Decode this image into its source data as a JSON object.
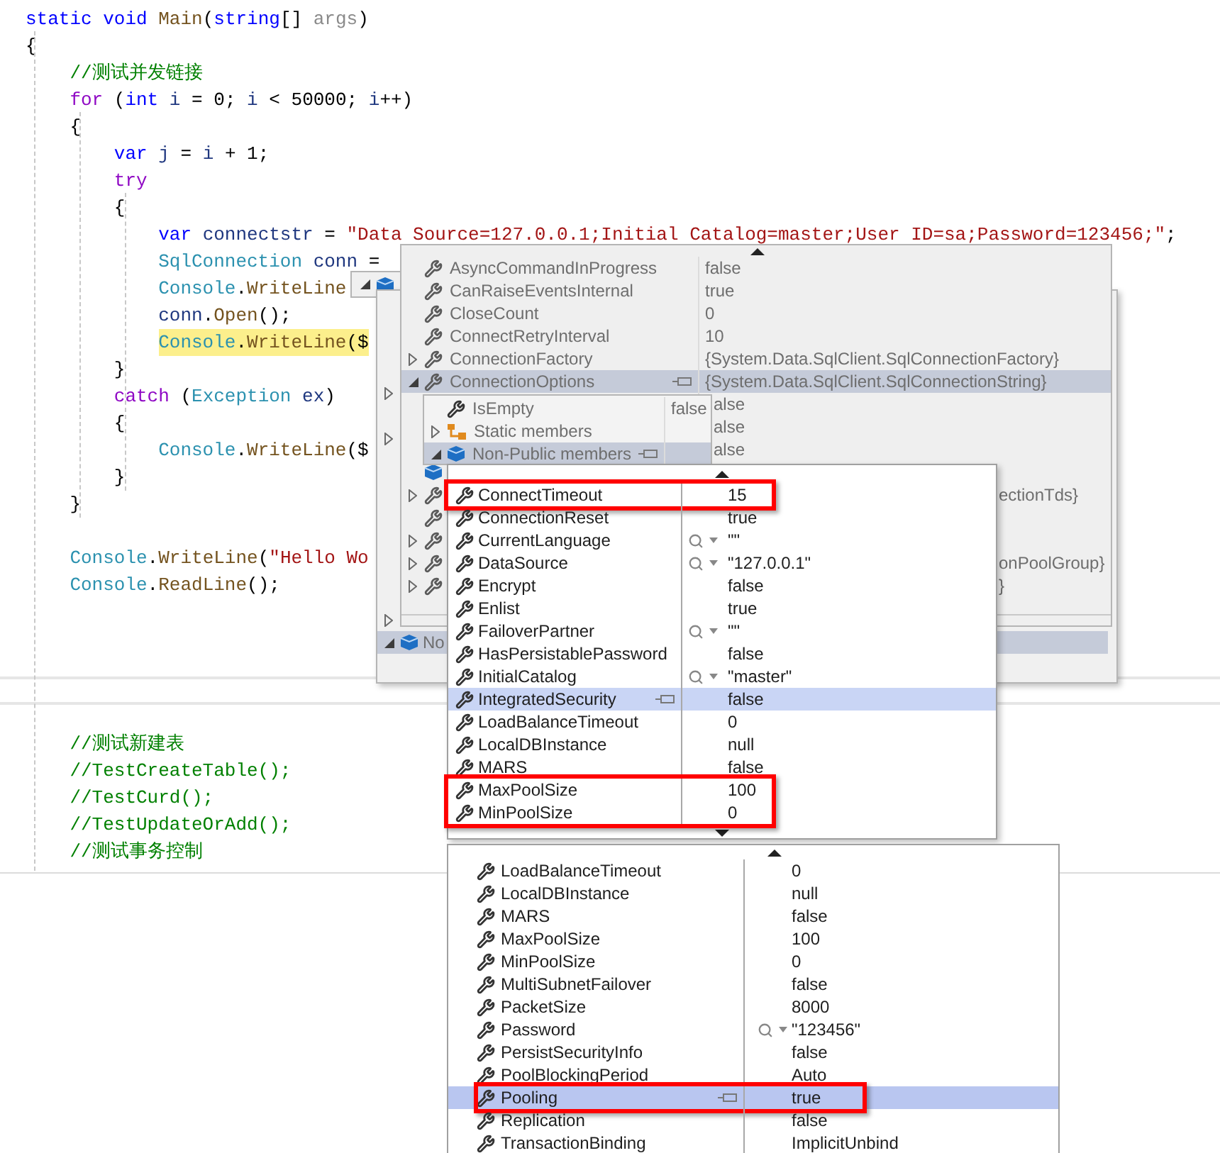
{
  "editor": {
    "blocks": [
      {
        "lines": [
          {
            "tokens": [
              {
                "kind": "keyword",
                "text": "static "
              },
              {
                "kind": "keyword",
                "text": "void "
              },
              {
                "kind": "method",
                "text": "Main"
              },
              {
                "kind": "plain",
                "text": "("
              },
              {
                "kind": "keyword",
                "text": "string"
              },
              {
                "kind": "plain",
                "text": "[] "
              },
              {
                "kind": "param",
                "text": "args"
              },
              {
                "kind": "plain",
                "text": ")"
              }
            ]
          },
          {
            "tokens": [
              {
                "kind": "plain",
                "text": "{"
              }
            ],
            "children": [
              {
                "tokens": [
                  {
                    "kind": "comment",
                    "text": "//测试并发链接"
                  }
                ]
              },
              {
                "tokens": [
                  {
                    "kind": "control",
                    "text": "for"
                  },
                  {
                    "kind": "plain",
                    "text": " ("
                  },
                  {
                    "kind": "keyword",
                    "text": "int "
                  },
                  {
                    "kind": "local",
                    "text": "i"
                  },
                  {
                    "kind": "plain",
                    "text": " = 0; "
                  },
                  {
                    "kind": "local",
                    "text": "i"
                  },
                  {
                    "kind": "plain",
                    "text": " < 50000; "
                  },
                  {
                    "kind": "local",
                    "text": "i"
                  },
                  {
                    "kind": "plain",
                    "text": "++)"
                  }
                ]
              },
              {
                "tokens": [
                  {
                    "kind": "plain",
                    "text": "{"
                  }
                ],
                "children": [
                  {
                    "tokens": [
                      {
                        "kind": "keyword",
                        "text": "var "
                      },
                      {
                        "kind": "local",
                        "text": "j"
                      },
                      {
                        "kind": "plain",
                        "text": " = "
                      },
                      {
                        "kind": "local",
                        "text": "i"
                      },
                      {
                        "kind": "plain",
                        "text": " + 1;"
                      }
                    ]
                  },
                  {
                    "tokens": [
                      {
                        "kind": "control",
                        "text": "try"
                      }
                    ]
                  },
                  {
                    "tokens": [
                      {
                        "kind": "plain",
                        "text": "{"
                      }
                    ],
                    "children": [
                      {
                        "tokens": [
                          {
                            "kind": "keyword",
                            "text": "var "
                          },
                          {
                            "kind": "local",
                            "text": "connectstr"
                          },
                          {
                            "kind": "plain",
                            "text": " = "
                          },
                          {
                            "kind": "string",
                            "text": "\"Data Source=127.0.0.1;Initial Catalog=master;User ID=sa;Password=123456;\""
                          },
                          {
                            "kind": "plain",
                            "text": ";"
                          }
                        ]
                      },
                      {
                        "tokens": [
                          {
                            "kind": "type",
                            "text": "SqlConnection "
                          },
                          {
                            "kind": "local",
                            "text": "conn"
                          },
                          {
                            "kind": "plain",
                            "text": " ="
                          }
                        ]
                      },
                      {
                        "tokens": [
                          {
                            "kind": "type",
                            "text": "Console"
                          },
                          {
                            "kind": "plain",
                            "text": "."
                          },
                          {
                            "kind": "method",
                            "text": "WriteLine"
                          }
                        ]
                      },
                      {
                        "tokens": [
                          {
                            "kind": "local",
                            "text": "conn"
                          },
                          {
                            "kind": "plain",
                            "text": "."
                          },
                          {
                            "kind": "method",
                            "text": "Open"
                          },
                          {
                            "kind": "plain",
                            "text": "();"
                          }
                        ]
                      },
                      {
                        "current": true,
                        "tokens": [
                          {
                            "kind": "type",
                            "text": "Console"
                          },
                          {
                            "kind": "plain",
                            "text": "."
                          },
                          {
                            "kind": "method",
                            "text": "WriteLine"
                          },
                          {
                            "kind": "plain",
                            "text": "($"
                          }
                        ]
                      }
                    ]
                  },
                  {
                    "tokens": [
                      {
                        "kind": "plain",
                        "text": "}"
                      }
                    ]
                  },
                  {
                    "tokens": [
                      {
                        "kind": "control",
                        "text": "catch"
                      },
                      {
                        "kind": "plain",
                        "text": " ("
                      },
                      {
                        "kind": "type",
                        "text": "Exception "
                      },
                      {
                        "kind": "local",
                        "text": "ex"
                      },
                      {
                        "kind": "plain",
                        "text": ")"
                      }
                    ]
                  },
                  {
                    "tokens": [
                      {
                        "kind": "plain",
                        "text": "{"
                      }
                    ],
                    "children": [
                      {
                        "tokens": [
                          {
                            "kind": "type",
                            "text": "Console"
                          },
                          {
                            "kind": "plain",
                            "text": "."
                          },
                          {
                            "kind": "method",
                            "text": "WriteLine"
                          },
                          {
                            "kind": "plain",
                            "text": "($"
                          }
                        ]
                      }
                    ]
                  },
                  {
                    "tokens": [
                      {
                        "kind": "plain",
                        "text": "}"
                      }
                    ]
                  }
                ]
              },
              {
                "tokens": [
                  {
                    "kind": "plain",
                    "text": "}"
                  }
                ]
              },
              {
                "kind": "blank"
              },
              {
                "tokens": [
                  {
                    "kind": "type",
                    "text": "Console"
                  },
                  {
                    "kind": "plain",
                    "text": "."
                  },
                  {
                    "kind": "method",
                    "text": "WriteLine"
                  },
                  {
                    "kind": "plain",
                    "text": "("
                  },
                  {
                    "kind": "string",
                    "text": "\"Hello Wo"
                  }
                ]
              },
              {
                "tokens": [
                  {
                    "kind": "type",
                    "text": "Console"
                  },
                  {
                    "kind": "plain",
                    "text": "."
                  },
                  {
                    "kind": "method",
                    "text": "ReadLine"
                  },
                  {
                    "kind": "plain",
                    "text": "();"
                  }
                ]
              }
            ]
          }
        ]
      },
      {
        "lines": [
          {
            "children": [
              {
                "tokens": [
                  {
                    "kind": "comment",
                    "text": "//测试新建表"
                  }
                ]
              },
              {
                "tokens": [
                  {
                    "kind": "comment",
                    "text": "//TestCreateTable();"
                  }
                ]
              },
              {
                "tokens": [
                  {
                    "kind": "comment",
                    "text": "//TestCurd();"
                  }
                ]
              },
              {
                "tokens": [
                  {
                    "kind": "comment",
                    "text": "//TestUpdateOrAdd();"
                  }
                ]
              },
              {
                "tokens": [
                  {
                    "kind": "comment",
                    "text": "//测试事务控制"
                  }
                ]
              }
            ]
          }
        ]
      }
    ]
  },
  "conn_tip": {
    "expanded": true,
    "rows": [
      {
        "kind": "stub",
        "expanded": false,
        "selected": false
      },
      {
        "kind": "stub",
        "expanded": false,
        "selected": false
      },
      {
        "kind": "stub",
        "expanded": false,
        "selected": false
      },
      {
        "kind": "object",
        "expanded": true,
        "name": "No",
        "selected": true
      }
    ]
  },
  "connection_members": {
    "rows": [
      {
        "kind": "property",
        "name": "AsyncCommandInProgress",
        "value": "false",
        "selected": false
      },
      {
        "kind": "property",
        "name": "CanRaiseEventsInternal",
        "value": "true",
        "selected": false
      },
      {
        "kind": "property",
        "name": "CloseCount",
        "value": "0",
        "selected": false
      },
      {
        "kind": "property",
        "name": "ConnectRetryInterval",
        "value": "10",
        "selected": false
      },
      {
        "kind": "property",
        "expanded": false,
        "name": "ConnectionFactory",
        "value": "{System.Data.SqlClient.SqlConnectionFactory}",
        "selected": false
      },
      {
        "kind": "property",
        "expanded": true,
        "name": "ConnectionOptions",
        "value": "{System.Data.SqlClient.SqlConnectionString}",
        "selected": true
      },
      {
        "kind": "covered_value",
        "value": "alse"
      },
      {
        "kind": "covered_value",
        "value": "alse"
      },
      {
        "kind": "covered_value",
        "value": "alse"
      },
      {
        "kind": "covered_object"
      },
      {
        "kind": "covered_property",
        "expanded": false,
        "value": "ectionTds}"
      },
      {
        "kind": "covered_property"
      },
      {
        "kind": "covered_property",
        "expanded": false
      },
      {
        "kind": "covered_property",
        "expanded": false,
        "value": "onPoolGroup}"
      },
      {
        "kind": "covered_property",
        "expanded": false,
        "value": "}"
      }
    ]
  },
  "options_groups": {
    "rows": [
      {
        "kind": "property",
        "name": "IsEmpty",
        "value": "false",
        "selected": false
      },
      {
        "kind": "static_group",
        "expanded": false,
        "name": "Static members",
        "selected": false
      },
      {
        "kind": "object_group",
        "expanded": true,
        "name": "Non-Public members",
        "selected": true
      }
    ]
  },
  "options_list": {
    "rows": [
      {
        "name": "ConnectTimeout",
        "value": "15",
        "selected": false,
        "marked": true
      },
      {
        "name": "ConnectionReset",
        "value": "true",
        "selected": false,
        "marked": false
      },
      {
        "name": "CurrentLanguage",
        "value": "\"\"",
        "inspect": true,
        "selected": false,
        "marked": false
      },
      {
        "name": "DataSource",
        "value": "\"127.0.0.1\"",
        "inspect": true,
        "selected": false,
        "marked": false
      },
      {
        "name": "Encrypt",
        "value": "false",
        "selected": false,
        "marked": false
      },
      {
        "name": "Enlist",
        "value": "true",
        "selected": false,
        "marked": false
      },
      {
        "name": "FailoverPartner",
        "value": "\"\"",
        "inspect": true,
        "selected": false,
        "marked": false
      },
      {
        "name": "HasPersistablePassword",
        "value": "false",
        "selected": false,
        "marked": false
      },
      {
        "name": "InitialCatalog",
        "value": "\"master\"",
        "inspect": true,
        "selected": false,
        "marked": false
      },
      {
        "name": "IntegratedSecurity",
        "value": "false",
        "selected": true,
        "marked": false
      },
      {
        "name": "LoadBalanceTimeout",
        "value": "0",
        "selected": false,
        "marked": false
      },
      {
        "name": "LocalDBInstance",
        "value": "null",
        "selected": false,
        "marked": false
      },
      {
        "name": "MARS",
        "value": "false",
        "selected": false,
        "marked": false
      },
      {
        "name": "MaxPoolSize",
        "value": "100",
        "selected": false,
        "marked": true
      },
      {
        "name": "MinPoolSize",
        "value": "0",
        "selected": false,
        "marked": true
      }
    ]
  },
  "options_list_scrolled": {
    "rows": [
      {
        "name": "LoadBalanceTimeout",
        "value": "0",
        "selected": false,
        "marked": false
      },
      {
        "name": "LocalDBInstance",
        "value": "null",
        "selected": false,
        "marked": false
      },
      {
        "name": "MARS",
        "value": "false",
        "selected": false,
        "marked": false
      },
      {
        "name": "MaxPoolSize",
        "value": "100",
        "selected": false,
        "marked": false
      },
      {
        "name": "MinPoolSize",
        "value": "0",
        "selected": false,
        "marked": false
      },
      {
        "name": "MultiSubnetFailover",
        "value": "false",
        "selected": false,
        "marked": false
      },
      {
        "name": "PacketSize",
        "value": "8000",
        "selected": false,
        "marked": false
      },
      {
        "name": "Password",
        "value": "\"123456\"",
        "inspect": true,
        "selected": false,
        "marked": false
      },
      {
        "name": "PersistSecurityInfo",
        "value": "false",
        "selected": false,
        "marked": false
      },
      {
        "name": "PoolBlockingPeriod",
        "value": "Auto",
        "selected": false,
        "marked": false
      },
      {
        "name": "Pooling",
        "value": "true",
        "selected": true,
        "marked": true
      },
      {
        "name": "Replication",
        "value": "false",
        "selected": false,
        "marked": false
      },
      {
        "name": "TransactionBinding",
        "value": "ImplicitUnbind",
        "selected": false,
        "marked": false
      }
    ]
  }
}
